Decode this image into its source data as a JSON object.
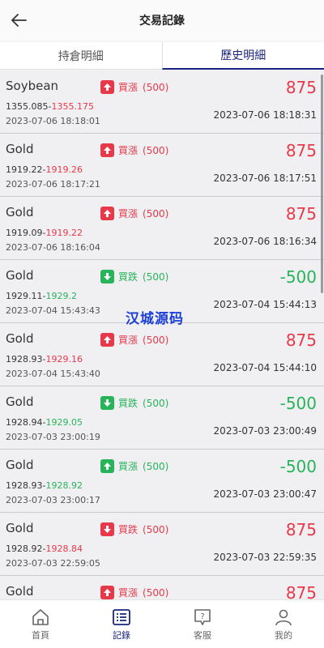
{
  "header": {
    "title": "交易記錄"
  },
  "tabs": [
    {
      "label": "持倉明細"
    },
    {
      "label": "歷史明細"
    }
  ],
  "watermark": "汉城源码",
  "colors": {
    "up": "#e8394a",
    "down": "#27b45a",
    "accent": "#1a237e"
  },
  "records": [
    {
      "symbol": "Soybean",
      "direction": "買漲",
      "direction_icon": "arrow-up-icon",
      "direction_color": "red",
      "amount": "(500)",
      "open_price": "1355.085-",
      "close_price": "1355.175",
      "close_color": "red",
      "open_time": "2023-07-06 18:18:01",
      "pnl": "875",
      "pnl_color": "red",
      "close_time": "2023-07-06 18:18:31"
    },
    {
      "symbol": "Gold",
      "direction": "買漲",
      "direction_icon": "arrow-up-icon",
      "direction_color": "red",
      "amount": "(500)",
      "open_price": "1919.22-",
      "close_price": "1919.26",
      "close_color": "red",
      "open_time": "2023-07-06 18:17:21",
      "pnl": "875",
      "pnl_color": "red",
      "close_time": "2023-07-06 18:17:51"
    },
    {
      "symbol": "Gold",
      "direction": "買漲",
      "direction_icon": "arrow-up-icon",
      "direction_color": "red",
      "amount": "(500)",
      "open_price": "1919.09-",
      "close_price": "1919.22",
      "close_color": "red",
      "open_time": "2023-07-06 18:16:04",
      "pnl": "875",
      "pnl_color": "red",
      "close_time": "2023-07-06 18:16:34"
    },
    {
      "symbol": "Gold",
      "direction": "買跌",
      "direction_icon": "arrow-down-icon",
      "direction_color": "green",
      "amount": "(500)",
      "open_price": "1929.11-",
      "close_price": "1929.2",
      "close_color": "green",
      "open_time": "2023-07-04 15:43:43",
      "pnl": "-500",
      "pnl_color": "green",
      "close_time": "2023-07-04 15:44:13"
    },
    {
      "symbol": "Gold",
      "direction": "買漲",
      "direction_icon": "arrow-up-icon",
      "direction_color": "red",
      "amount": "(500)",
      "open_price": "1928.93-",
      "close_price": "1929.16",
      "close_color": "red",
      "open_time": "2023-07-04 15:43:40",
      "pnl": "875",
      "pnl_color": "red",
      "close_time": "2023-07-04 15:44:10"
    },
    {
      "symbol": "Gold",
      "direction": "買跌",
      "direction_icon": "arrow-down-icon",
      "direction_color": "green",
      "amount": "(500)",
      "open_price": "1928.94-",
      "close_price": "1929.05",
      "close_color": "green",
      "open_time": "2023-07-03 23:00:19",
      "pnl": "-500",
      "pnl_color": "green",
      "close_time": "2023-07-03 23:00:49"
    },
    {
      "symbol": "Gold",
      "direction": "買漲",
      "direction_icon": "arrow-up-icon",
      "direction_color": "green",
      "amount": "(500)",
      "open_price": "1928.93-",
      "close_price": "1928.92",
      "close_color": "green",
      "open_time": "2023-07-03 23:00:17",
      "pnl": "-500",
      "pnl_color": "green",
      "close_time": "2023-07-03 23:00:47"
    },
    {
      "symbol": "Gold",
      "direction": "買跌",
      "direction_icon": "arrow-down-icon",
      "direction_color": "red",
      "amount": "(500)",
      "open_price": "1928.92-",
      "close_price": "1928.84",
      "close_color": "red",
      "open_time": "2023-07-03 22:59:05",
      "pnl": "875",
      "pnl_color": "red",
      "close_time": "2023-07-03 22:59:35"
    },
    {
      "symbol": "Gold",
      "direction": "買漲",
      "direction_icon": "arrow-up-icon",
      "direction_color": "red",
      "amount": "(500)",
      "open_price": "",
      "close_price": "",
      "close_color": "red",
      "open_time": "",
      "pnl": "875",
      "pnl_color": "red",
      "close_time": ""
    }
  ],
  "nav": [
    {
      "label": "首頁",
      "icon": "home-icon"
    },
    {
      "label": "記錄",
      "icon": "records-icon"
    },
    {
      "label": "客服",
      "icon": "support-icon"
    },
    {
      "label": "我的",
      "icon": "profile-icon"
    }
  ]
}
